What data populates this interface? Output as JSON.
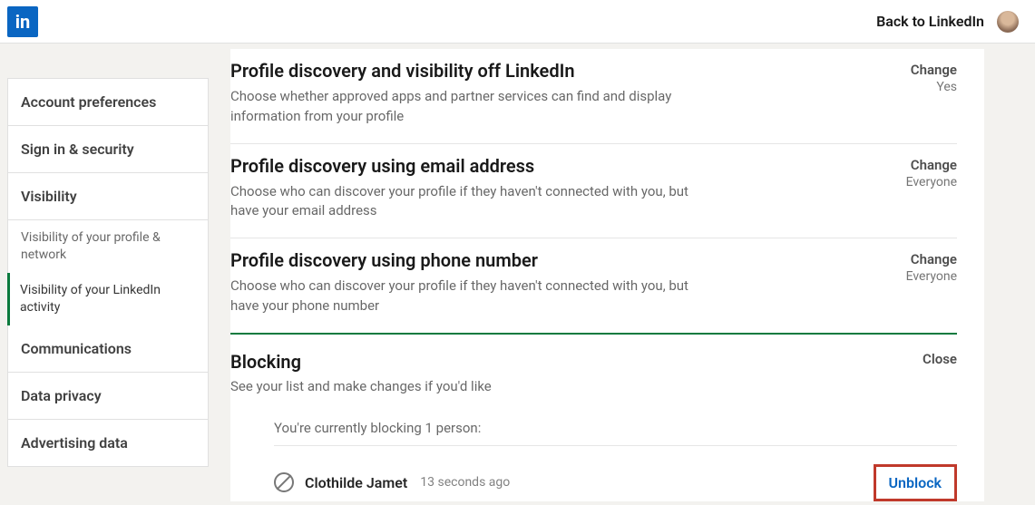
{
  "header": {
    "logo_text": "in",
    "back_label": "Back to LinkedIn"
  },
  "sidebar": {
    "items": [
      {
        "label": "Account preferences"
      },
      {
        "label": "Sign in & security"
      },
      {
        "label": "Visibility"
      },
      {
        "label": "Communications"
      },
      {
        "label": "Data privacy"
      },
      {
        "label": "Advertising data"
      }
    ],
    "sub_items": [
      {
        "label": "Visibility of your profile & network"
      },
      {
        "label": "Visibility of your LinkedIn activity"
      }
    ]
  },
  "settings": [
    {
      "title": "Profile discovery and visibility off LinkedIn",
      "desc": "Choose whether approved apps and partner services can find and display information from your profile",
      "action": "Change",
      "value": "Yes"
    },
    {
      "title": "Profile discovery using email address",
      "desc": "Choose who can discover your profile if they haven't connected with you, but have your email address",
      "action": "Change",
      "value": "Everyone"
    },
    {
      "title": "Profile discovery using phone number",
      "desc": "Choose who can discover your profile if they haven't connected with you, but have your phone number",
      "action": "Change",
      "value": "Everyone"
    }
  ],
  "blocking": {
    "title": "Blocking",
    "subtitle": "See your list and make changes if you'd like",
    "close_label": "Close",
    "count_text": "You're currently blocking 1 person:",
    "entries": [
      {
        "name": "Clothilde Jamet",
        "time": "13 seconds ago",
        "unblock_label": "Unblock"
      }
    ]
  }
}
